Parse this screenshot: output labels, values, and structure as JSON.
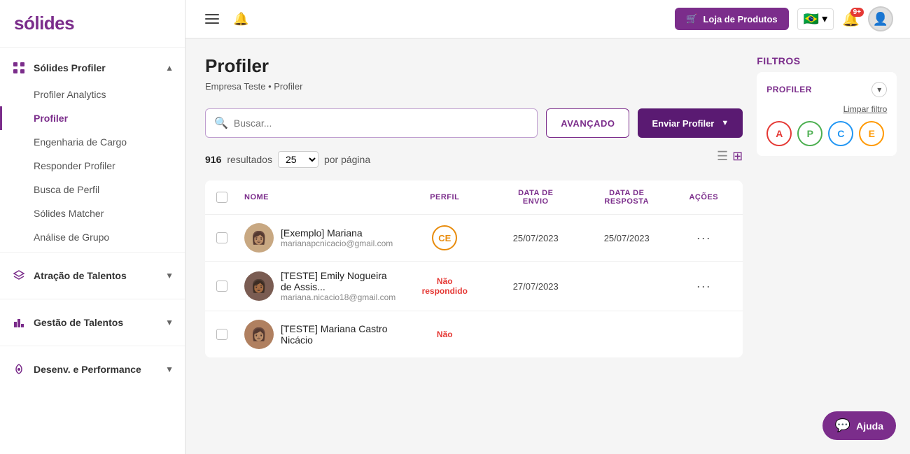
{
  "app": {
    "logo": "sólides",
    "topbar": {
      "shop_btn": "Loja de Produtos",
      "flag_emoji": "🇧🇷",
      "notif_count": "9+",
      "chevron": "▾"
    }
  },
  "sidebar": {
    "group1": {
      "label": "Sólides Profiler",
      "icon": "grid",
      "items": [
        {
          "id": "profiler-analytics",
          "label": "Profiler Analytics",
          "active": false
        },
        {
          "id": "profiler",
          "label": "Profiler",
          "active": true
        },
        {
          "id": "engenharia-de-cargo",
          "label": "Engenharia de Cargo",
          "active": false
        },
        {
          "id": "responder-profiler",
          "label": "Responder Profiler",
          "active": false
        },
        {
          "id": "busca-de-perfil",
          "label": "Busca de Perfil",
          "active": false
        },
        {
          "id": "solides-matcher",
          "label": "Sólides Matcher",
          "active": false
        },
        {
          "id": "analise-de-grupo",
          "label": "Análise de Grupo",
          "active": false
        }
      ]
    },
    "group2": {
      "label": "Atração de Talentos"
    },
    "group3": {
      "label": "Gestão de Talentos"
    },
    "group4": {
      "label": "Desenv. e Performance"
    }
  },
  "page": {
    "title": "Profiler",
    "breadcrumb_company": "Empresa Teste",
    "breadcrumb_separator": "•",
    "breadcrumb_page": "Profiler"
  },
  "toolbar": {
    "search_placeholder": "Buscar...",
    "advanced_btn": "AVANÇADO",
    "send_profiler_btn": "Enviar Profiler"
  },
  "results": {
    "count": "916",
    "label": "resultados",
    "per_page": "25",
    "per_page_label": "por página"
  },
  "table": {
    "columns": [
      {
        "id": "check",
        "label": ""
      },
      {
        "id": "nome",
        "label": "NOME"
      },
      {
        "id": "perfil",
        "label": "PERFIL"
      },
      {
        "id": "data_envio",
        "label": "DATA DE ENVIO"
      },
      {
        "id": "data_resposta",
        "label": "DATA DE RESPOSTA"
      },
      {
        "id": "acoes",
        "label": "AÇÕES"
      }
    ],
    "rows": [
      {
        "id": 1,
        "name": "[Exemplo] Mariana",
        "email": "marianapcnicacio@gmail.com",
        "profile_code": "CE",
        "date_sent": "25/07/2023",
        "date_response": "25/07/2023",
        "avatar_color": "#c8a882",
        "profile_border": "#e88c0d"
      },
      {
        "id": 2,
        "name": "[TESTE] Emily Nogueira de Assis...",
        "email": "mariana.nicacio18@gmail.com",
        "profile_code": "Não respondido",
        "date_sent": "27/07/2023",
        "date_response": "",
        "avatar_color": "#7a5c52",
        "profile_border": ""
      },
      {
        "id": 3,
        "name": "[TESTE] Mariana Castro Nicácio",
        "email": "",
        "profile_code": "Não",
        "date_sent": "",
        "date_response": "",
        "avatar_color": "#b08060",
        "profile_border": ""
      }
    ]
  },
  "filters": {
    "title": "FILTROS",
    "profiler_label": "PROFILER",
    "clear_label": "Limpar filtro",
    "badges": [
      {
        "letter": "A",
        "color": "#e53935",
        "border": "#e53935"
      },
      {
        "letter": "P",
        "color": "#4caf50",
        "border": "#4caf50"
      },
      {
        "letter": "C",
        "color": "#2196f3",
        "border": "#2196f3"
      },
      {
        "letter": "E",
        "color": "#ff9800",
        "border": "#ff9800"
      }
    ]
  },
  "help": {
    "label": "Ajuda"
  }
}
